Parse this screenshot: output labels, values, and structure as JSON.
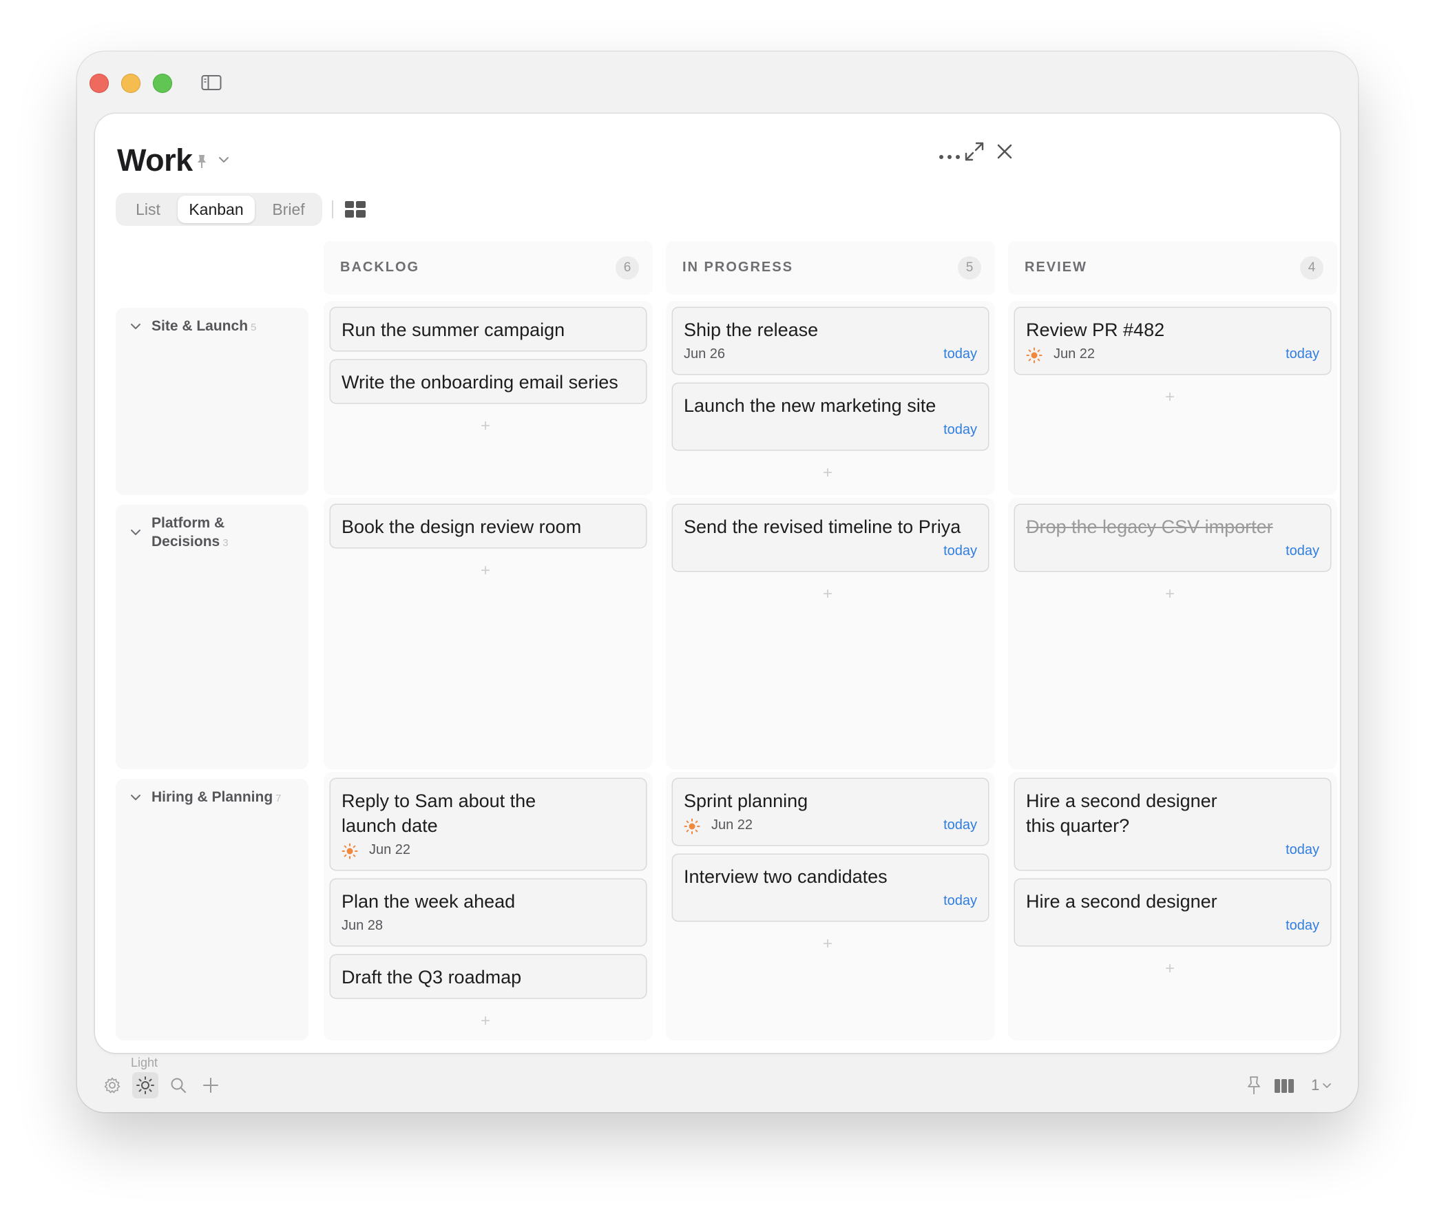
{
  "window": {
    "title": "Work",
    "traffic_lights": {
      "close_color": "#ee6a5e",
      "minimize_color": "#f5bd4f",
      "zoom_color": "#61c554"
    }
  },
  "view_tabs": [
    {
      "label": "List",
      "active": false
    },
    {
      "label": "Kanban",
      "active": true
    },
    {
      "label": "Brief",
      "active": false
    }
  ],
  "columns": [
    {
      "title": "BACKLOG",
      "count": "6"
    },
    {
      "title": "IN PROGRESS",
      "count": "5"
    },
    {
      "title": "REVIEW",
      "count": "4"
    }
  ],
  "groups": [
    {
      "name": "Site & Launch",
      "count": "5"
    },
    {
      "name": "Platform & Decisions",
      "count": "3"
    },
    {
      "name": "Hiring & Planning",
      "count": "7"
    }
  ],
  "cards": {
    "site_backlog": [
      {
        "title": "Run the summer campaign"
      },
      {
        "title": "Write the onboarding email series"
      }
    ],
    "site_progress": [
      {
        "title": "Ship the release",
        "date": "Jun 26",
        "due": "today"
      },
      {
        "title": "Launch the new marketing site",
        "due": "today"
      }
    ],
    "site_review": [
      {
        "title": "Review PR #482",
        "date": "Jun 22",
        "due": "today",
        "icon": "sun-icon"
      }
    ],
    "platform_backlog": [
      {
        "title": "Book the design review room"
      }
    ],
    "platform_progress": [
      {
        "title": "Send the revised timeline to Priya",
        "due": "today"
      }
    ],
    "platform_review": [
      {
        "title": "Drop the legacy CSV importer",
        "due": "today",
        "completed": true
      }
    ],
    "hiring_backlog": [
      {
        "title": "Reply to Sam about the launch date",
        "date": "Jun 22",
        "icon": "sun-icon"
      },
      {
        "title": "Plan the week ahead",
        "date": "Jun 28"
      },
      {
        "title": "Draft the Q3 roadmap"
      }
    ],
    "hiring_progress": [
      {
        "title": "Sprint planning",
        "date": "Jun 22",
        "due": "today",
        "icon": "sun-icon"
      },
      {
        "title": "Interview two candidates",
        "due": "today"
      }
    ],
    "hiring_review": [
      {
        "title": "Hire a second designer this quarter?",
        "due": "today"
      },
      {
        "title": "Hire a second designer",
        "due": "today"
      }
    ]
  },
  "add_symbol": "+",
  "bottom_bar": {
    "theme_label": "Light",
    "page_indicator": "1"
  },
  "colors": {
    "accent_today": "#2f7de1",
    "sun": "#f0883e",
    "card_border": "#d9d9d9"
  }
}
